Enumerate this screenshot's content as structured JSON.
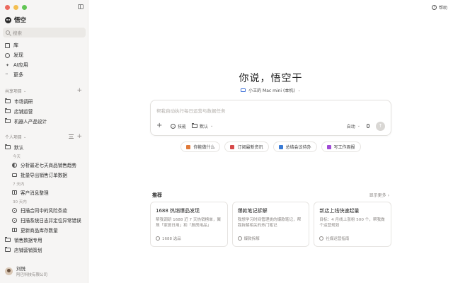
{
  "app": {
    "name": "悟空",
    "help_label": "帮助"
  },
  "search": {
    "placeholder": "搜索"
  },
  "nav": [
    {
      "label": "库",
      "icon": "library-icon"
    },
    {
      "label": "发现",
      "icon": "compass-icon"
    },
    {
      "label": "AI应用",
      "icon": "ai-app-icon"
    },
    {
      "label": "更多",
      "icon": "more-icon"
    }
  ],
  "shared": {
    "label": "共享项目",
    "items": [
      "市场调研",
      "店铺运营",
      "机器人产品设计"
    ]
  },
  "personal": {
    "label": "个人项目",
    "default_label": "默认",
    "groups": [
      {
        "date": "今天",
        "items": [
          "分析最近七天商品销售趋势",
          "批量导出销售订单数据"
        ]
      },
      {
        "date": "7 天内",
        "items": [
          "客户消息整理"
        ]
      },
      {
        "date": "30 天内",
        "items": [
          "扫描合同中的风险条款",
          "扫描系统日志并定位异常错误",
          "更新商品库存数量"
        ]
      }
    ],
    "folders": [
      "销售数据专用",
      "店铺营销策划"
    ]
  },
  "user": {
    "name": "刘悦",
    "org": "阿巴科技有限公司"
  },
  "main": {
    "headline": "你说，悟空干",
    "device": "小王的 Mac mini (本机)",
    "composer_placeholder": "帮我自动执行每日运营与数据任务",
    "skills_label": "技能",
    "default_label": "默认",
    "mode_label": "自动",
    "quick_actions": [
      {
        "label": "你能做什么",
        "color": "#e07a3a"
      },
      {
        "label": "订阅最新资讯",
        "color": "#d64a4a"
      },
      {
        "label": "总结会议待办",
        "color": "#3a7bd5"
      },
      {
        "label": "写工作周报",
        "color": "#a04ad6"
      }
    ],
    "recommend_title": "推荐",
    "show_more": "显示更多",
    "cards": [
      {
        "title": "1688 热销爆品发现",
        "desc": "帮我调研 1688 近 7 天热销榜单，聚焦「家居日用」和「厨房用品」",
        "tag": "1688 选品"
      },
      {
        "title": "爆款笔记拆解",
        "desc": "我想学习时间管理类的爆款笔记，帮我拆解相关的热门笔记",
        "tag": "爆款拆解"
      },
      {
        "title": "新店上线快速起量",
        "desc": "目标：4 月线上涨粉 500 个，帮我做个运营规划",
        "tag": "社媒运营指南"
      }
    ]
  }
}
